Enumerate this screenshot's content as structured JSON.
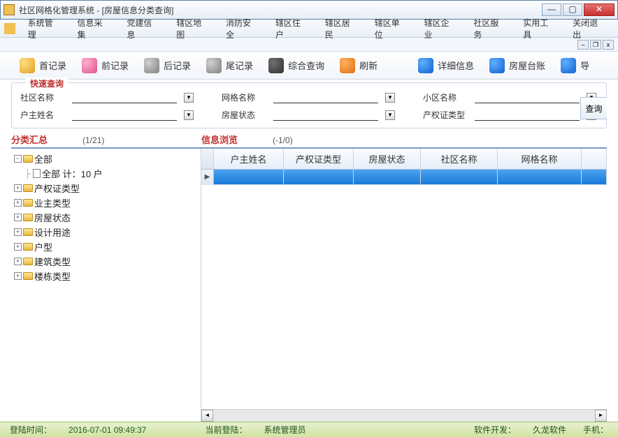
{
  "window": {
    "title": "社区网格化管理系统 - [房屋信息分类查询]"
  },
  "menus": [
    "系统管理",
    "信息采集",
    "党建信息",
    "辖区地图",
    "消防安全",
    "辖区住户",
    "辖区居民",
    "辖区单位",
    "辖区企业",
    "社区服务",
    "实用工具",
    "关闭退出"
  ],
  "toolbar": [
    {
      "label": "首记录",
      "color": "yellow",
      "name": "first-record"
    },
    {
      "label": "前记录",
      "color": "pink",
      "name": "prev-record"
    },
    {
      "label": "后记录",
      "color": "gray",
      "name": "next-record"
    },
    {
      "label": "尾记录",
      "color": "gray",
      "name": "last-record"
    },
    {
      "label": "综合查询",
      "color": "dark",
      "name": "combined-query"
    },
    {
      "label": "刷新",
      "color": "orange",
      "name": "refresh"
    },
    {
      "label": "详细信息",
      "color": "blue",
      "name": "detail-info"
    },
    {
      "label": "房屋台账",
      "color": "blue",
      "name": "house-ledger"
    },
    {
      "label": "导",
      "color": "blue",
      "name": "export"
    }
  ],
  "query": {
    "title": "快速查询",
    "fields": {
      "community_name_label": "社区名称",
      "grid_name_label": "网格名称",
      "xiaoqu_name_label": "小区名称",
      "owner_name_label": "户主姓名",
      "house_status_label": "房屋状态",
      "cert_type_label": "产权证类型"
    },
    "search_btn": "查询"
  },
  "sections": {
    "category_title": "分类汇总",
    "category_count": "(1/21)",
    "info_title": "信息浏览",
    "info_count": "(-1/0)"
  },
  "tree": {
    "root": "全部",
    "root_detail": "全部   计：10 户",
    "nodes": [
      "产权证类型",
      "业主类型",
      "房屋状态",
      "设计用途",
      "户型",
      "建筑类型",
      "楼栋类型"
    ]
  },
  "grid": {
    "columns": [
      "户主姓名",
      "产权证类型",
      "房屋状态",
      "社区名称",
      "网格名称"
    ]
  },
  "status": {
    "login_time_label": "登陆时间：",
    "login_time": "2016-07-01 09:49:37",
    "current_login_label": "当前登陆：",
    "current_login": "系统管理员",
    "dev_label": "软件开发：",
    "dev": "久龙软件",
    "phone_label": "手机："
  }
}
